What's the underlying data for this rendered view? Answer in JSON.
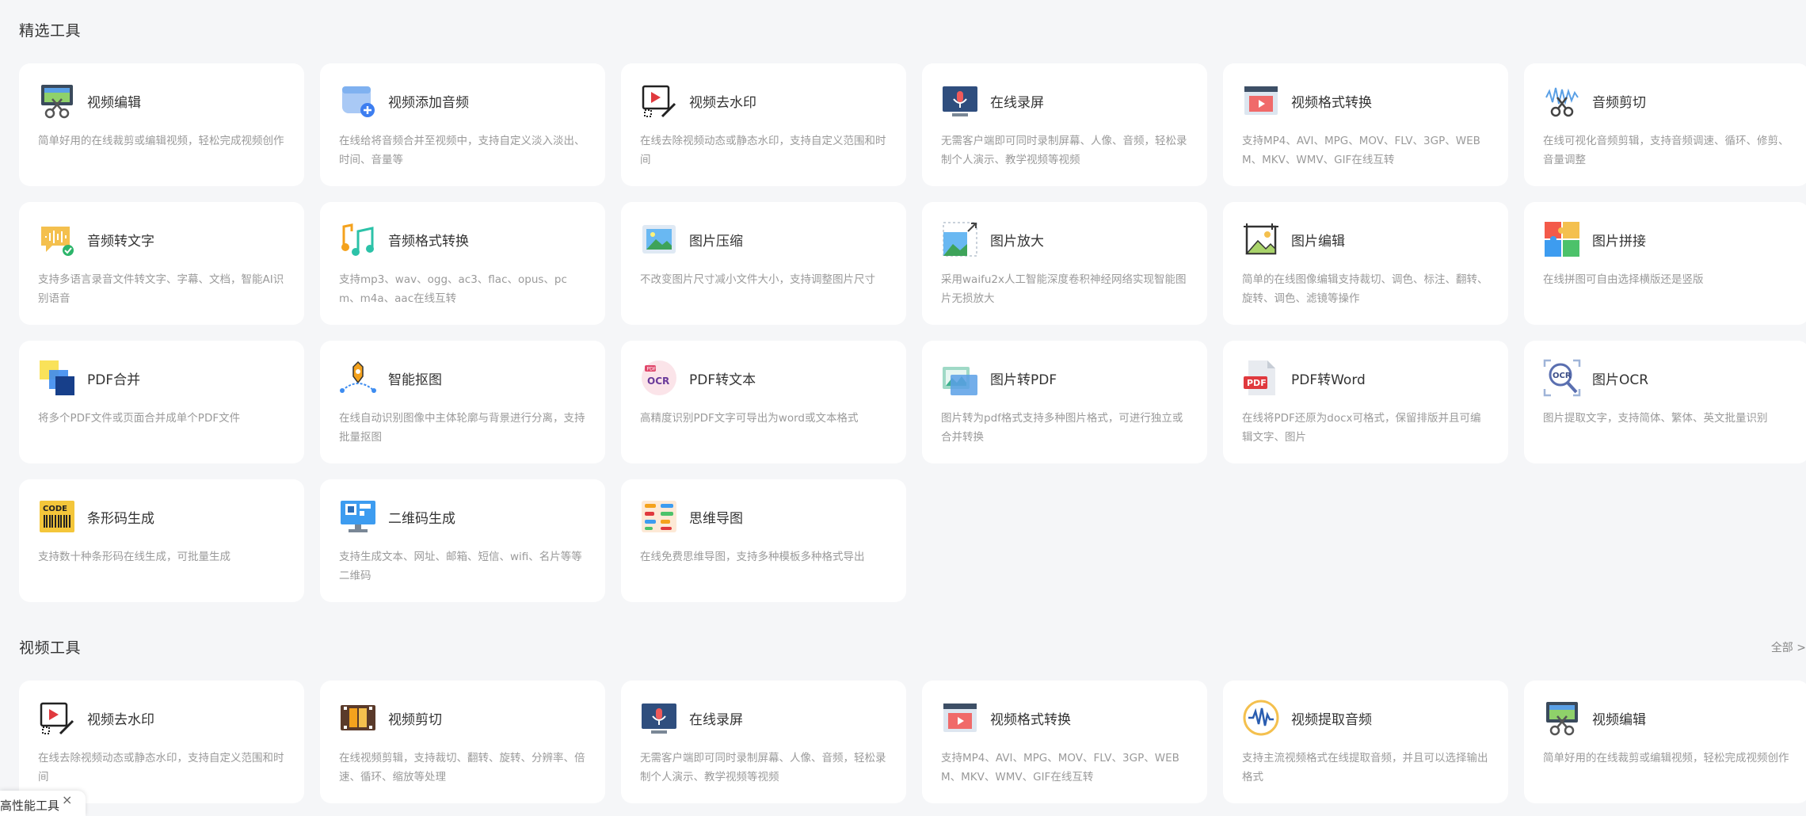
{
  "featured": {
    "title": "精选工具",
    "tools": [
      {
        "icon": "video-edit-icon",
        "title": "视频编辑",
        "desc": "简单好用的在线裁剪或编辑视频，轻松完成视频创作"
      },
      {
        "icon": "video-add-audio-icon",
        "title": "视频添加音频",
        "desc": "在线给将音频合并至视频中，支持自定义淡入淡出、时间、音量等"
      },
      {
        "icon": "video-remove-watermark-icon",
        "title": "视频去水印",
        "desc": "在线去除视频动态或静态水印，支持自定义范围和时间"
      },
      {
        "icon": "screen-record-icon",
        "title": "在线录屏",
        "desc": "无需客户端即可同时录制屏幕、人像、音频，轻松录制个人演示、教学视频等视频"
      },
      {
        "icon": "video-convert-icon",
        "title": "视频格式转换",
        "desc": "支持MP4、AVI、MPG、MOV、FLV、3GP、WEBM、MKV、WMV、GIF在线互转"
      },
      {
        "icon": "audio-cut-icon",
        "title": "音频剪切",
        "desc": "在线可视化音频剪辑，支持音频调速、循环、修剪、音量调整"
      },
      {
        "icon": "audio-to-text-icon",
        "title": "音频转文字",
        "desc": "支持多语言录音文件转文字、字幕、文档，智能AI识别语音"
      },
      {
        "icon": "audio-convert-icon",
        "title": "音频格式转换",
        "desc": "支持mp3、wav、ogg、ac3、flac、opus、pcm、m4a、aac在线互转"
      },
      {
        "icon": "image-compress-icon",
        "title": "图片压缩",
        "desc": "不改变图片尺寸减小文件大小，支持调整图片尺寸"
      },
      {
        "icon": "image-enlarge-icon",
        "title": "图片放大",
        "desc": "采用waifu2x人工智能深度卷积神经网络实现智能图片无损放大"
      },
      {
        "icon": "image-edit-icon",
        "title": "图片编辑",
        "desc": "简单的在线图像编辑支持裁切、调色、标注、翻转、旋转、调色、滤镜等操作"
      },
      {
        "icon": "image-collage-icon",
        "title": "图片拼接",
        "desc": "在线拼图可自由选择横版还是竖版"
      },
      {
        "icon": "pdf-merge-icon",
        "title": "PDF合并",
        "desc": "将多个PDF文件或页面合并成单个PDF文件"
      },
      {
        "icon": "smart-cutout-icon",
        "title": "智能抠图",
        "desc": "在线自动识别图像中主体轮廓与背景进行分离，支持批量抠图"
      },
      {
        "icon": "pdf-to-text-icon",
        "title": "PDF转文本",
        "desc": "高精度识别PDF文字可导出为word或文本格式"
      },
      {
        "icon": "image-to-pdf-icon",
        "title": "图片转PDF",
        "desc": "图片转为pdf格式支持多种图片格式，可进行独立或合并转换"
      },
      {
        "icon": "pdf-to-word-icon",
        "title": "PDF转Word",
        "desc": "在线将PDF还原为docx可格式，保留排版并且可编辑文字、图片"
      },
      {
        "icon": "image-ocr-icon",
        "title": "图片OCR",
        "desc": "图片提取文字，支持简体、繁体、英文批量识别"
      },
      {
        "icon": "barcode-icon",
        "title": "条形码生成",
        "desc": "支持数十种条形码在线生成，可批量生成"
      },
      {
        "icon": "qrcode-icon",
        "title": "二维码生成",
        "desc": "支持生成文本、网址、邮箱、短信、wifi、名片等等二维码"
      },
      {
        "icon": "mindmap-icon",
        "title": "思维导图",
        "desc": "在线免费思维导图，支持多种模板多种格式导出"
      }
    ]
  },
  "video": {
    "title": "视频工具",
    "more_label": "全部 >",
    "tools": [
      {
        "icon": "video-remove-watermark-icon",
        "title": "视频去水印",
        "desc": "在线去除视频动态或静态水印，支持自定义范围和时间"
      },
      {
        "icon": "video-cut-icon",
        "title": "视频剪切",
        "desc": "在线视频剪辑，支持裁切、翻转、旋转、分辨率、倍速、循环、缩放等处理"
      },
      {
        "icon": "screen-record-icon",
        "title": "在线录屏",
        "desc": "无需客户端即可同时录制屏幕、人像、音频，轻松录制个人演示、教学视频等视频"
      },
      {
        "icon": "video-convert-icon",
        "title": "视频格式转换",
        "desc": "支持MP4、AVI、MPG、MOV、FLV、3GP、WEBM、MKV、WMV、GIF在线互转"
      },
      {
        "icon": "video-extract-audio-icon",
        "title": "视频提取音频",
        "desc": "支持主流视频格式在线提取音频，并且可以选择输出格式"
      },
      {
        "icon": "video-edit-icon",
        "title": "视频编辑",
        "desc": "简单好用的在线裁剪或编辑视频，轻松完成视频创作"
      }
    ]
  },
  "floating": {
    "label": "高性能工具",
    "close": "×"
  }
}
